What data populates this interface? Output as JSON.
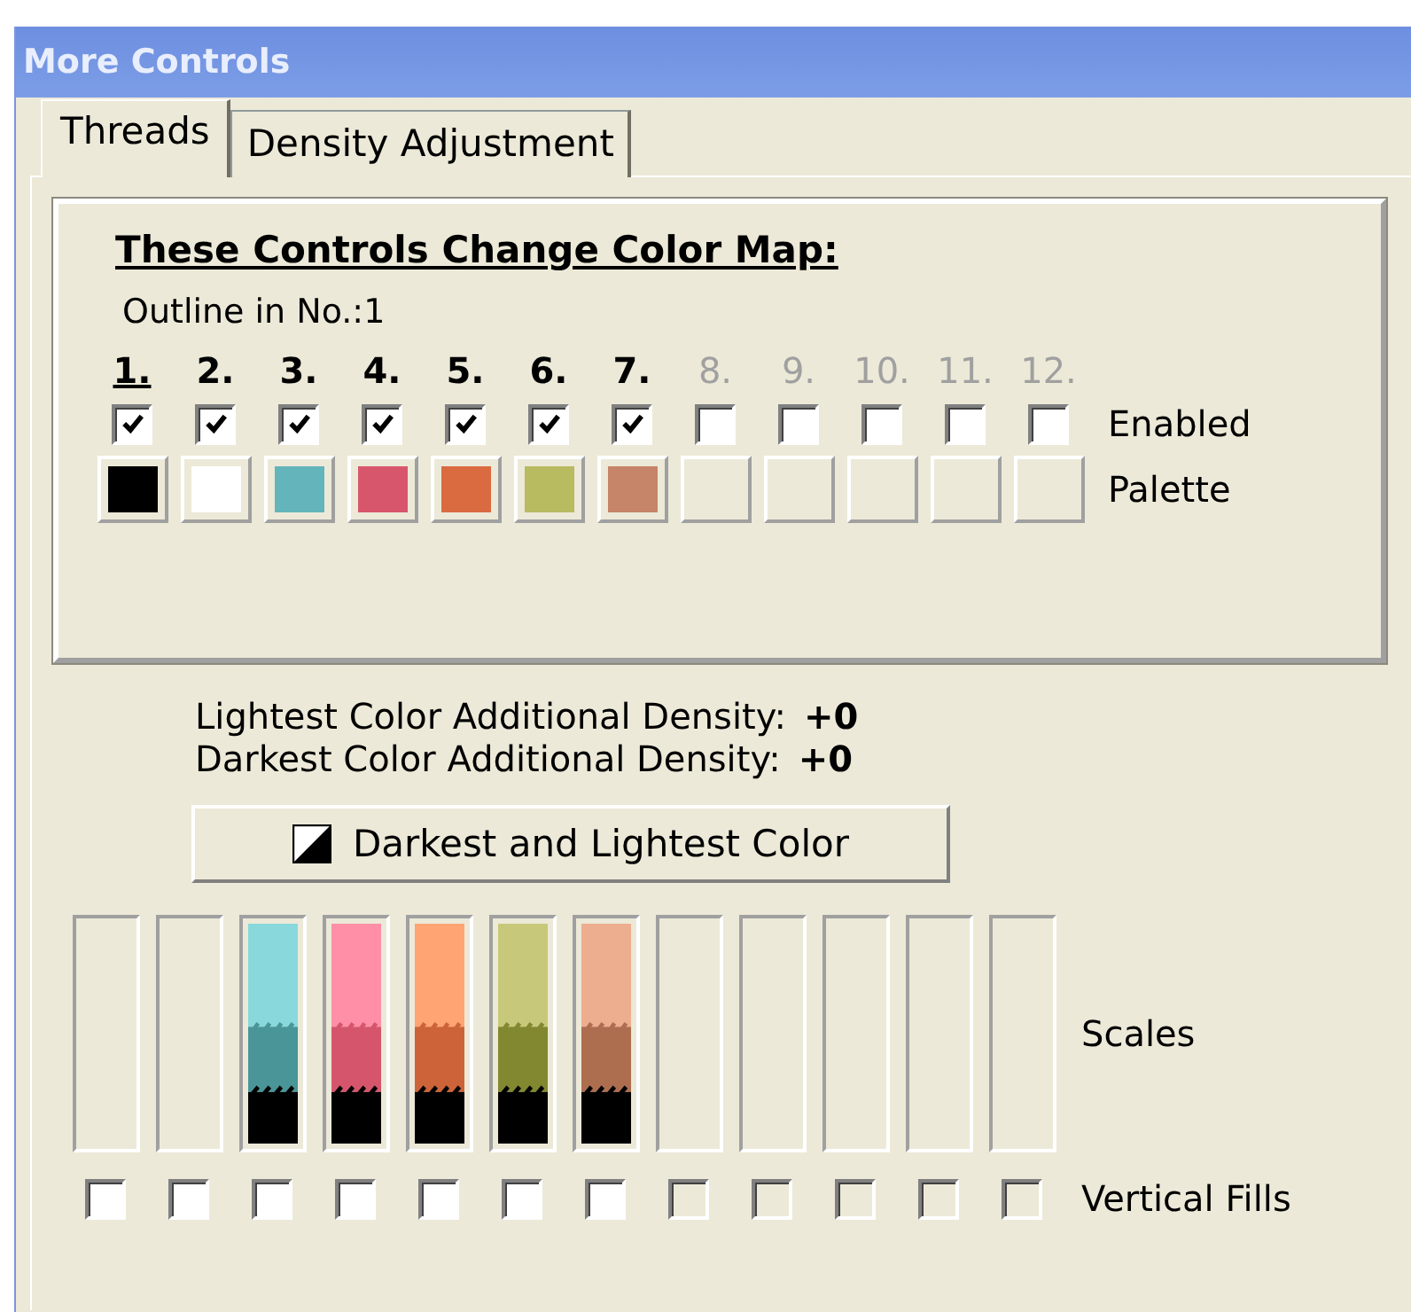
{
  "window": {
    "title": "More Controls"
  },
  "tabs": [
    {
      "label": "Threads",
      "selected": true
    },
    {
      "label": "Density Adjustment",
      "selected": false
    }
  ],
  "color_map": {
    "heading": "These Controls Change Color Map:",
    "outline_text": "Outline in No.:1",
    "enabled_label": "Enabled",
    "palette_label": "Palette",
    "threads": [
      {
        "label": "1.",
        "active": true,
        "outline": true,
        "checked": true,
        "color": "#000000"
      },
      {
        "label": "2.",
        "active": true,
        "outline": false,
        "checked": true,
        "color": "#ffffff"
      },
      {
        "label": "3.",
        "active": true,
        "outline": false,
        "checked": true,
        "color": "#63b5bb"
      },
      {
        "label": "4.",
        "active": true,
        "outline": false,
        "checked": true,
        "color": "#d8566c"
      },
      {
        "label": "5.",
        "active": true,
        "outline": false,
        "checked": true,
        "color": "#da6b40"
      },
      {
        "label": "6.",
        "active": true,
        "outline": false,
        "checked": true,
        "color": "#b8bb60"
      },
      {
        "label": "7.",
        "active": true,
        "outline": false,
        "checked": true,
        "color": "#c68468"
      },
      {
        "label": "8.",
        "active": false,
        "outline": false,
        "checked": false
      },
      {
        "label": "9.",
        "active": false,
        "outline": false,
        "checked": false
      },
      {
        "label": "10.",
        "active": false,
        "outline": false,
        "checked": false
      },
      {
        "label": "11.",
        "active": false,
        "outline": false,
        "checked": false
      },
      {
        "label": "12.",
        "active": false,
        "outline": false,
        "checked": false
      }
    ]
  },
  "density": {
    "lines": [
      {
        "label": "Lightest Color Additional Density:",
        "value": "+0"
      },
      {
        "label": "Darkest Color Additional Density:",
        "value": "+0"
      }
    ],
    "button": "Darkest and Lightest Color"
  },
  "scales": {
    "label": "Scales",
    "fills_label": "Vertical Fills",
    "items": [
      {
        "disabled": false,
        "checked": false
      },
      {
        "disabled": false,
        "checked": false
      },
      {
        "disabled": false,
        "checked": false,
        "bands": [
          {
            "color": "#88d8dc"
          },
          {
            "color": "#4a9598"
          },
          {
            "color": "#000000"
          }
        ]
      },
      {
        "disabled": false,
        "checked": false,
        "bands": [
          {
            "color": "#ff8fa6"
          },
          {
            "color": "#d5566c"
          },
          {
            "color": "#000000"
          }
        ]
      },
      {
        "disabled": false,
        "checked": false,
        "bands": [
          {
            "color": "#ffa472"
          },
          {
            "color": "#cd6338"
          },
          {
            "color": "#000000"
          }
        ]
      },
      {
        "disabled": false,
        "checked": false,
        "bands": [
          {
            "color": "#c8c87a"
          },
          {
            "color": "#818830"
          },
          {
            "color": "#000000"
          }
        ]
      },
      {
        "disabled": false,
        "checked": false,
        "bands": [
          {
            "color": "#ecae8e"
          },
          {
            "color": "#ad6e50"
          },
          {
            "color": "#000000"
          }
        ]
      },
      {
        "disabled": true,
        "checked": false
      },
      {
        "disabled": true,
        "checked": false
      },
      {
        "disabled": true,
        "checked": false
      },
      {
        "disabled": true,
        "checked": false
      },
      {
        "disabled": true,
        "checked": false
      }
    ]
  }
}
